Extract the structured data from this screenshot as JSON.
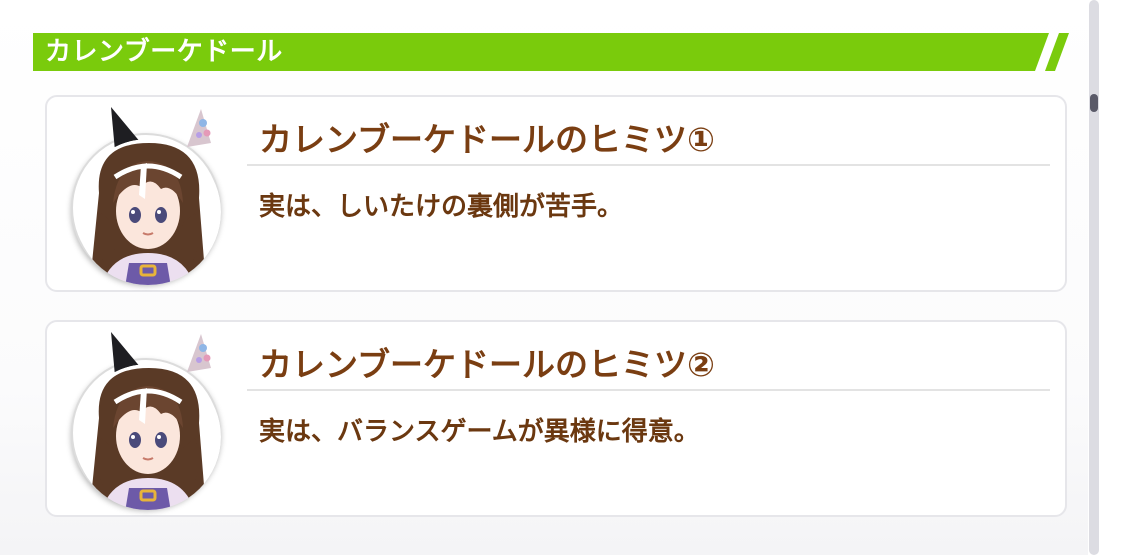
{
  "section": {
    "title": "カレンブーケドール",
    "accent_color": "#7acb0c"
  },
  "cards": [
    {
      "title": "カレンブーケドールのヒミツ①",
      "body": "実は、しいたけの裏側が苦手。",
      "avatar_icon": "character-portrait-icon"
    },
    {
      "title": "カレンブーケドールのヒミツ②",
      "body": "実は、バランスゲームが異様に得意。",
      "avatar_icon": "character-portrait-icon"
    }
  ],
  "colors": {
    "title_text": "#7a3e12",
    "body_text": "#6b3810",
    "card_border": "#e6e6ea",
    "scroll_thumb": "#5a5a68"
  }
}
